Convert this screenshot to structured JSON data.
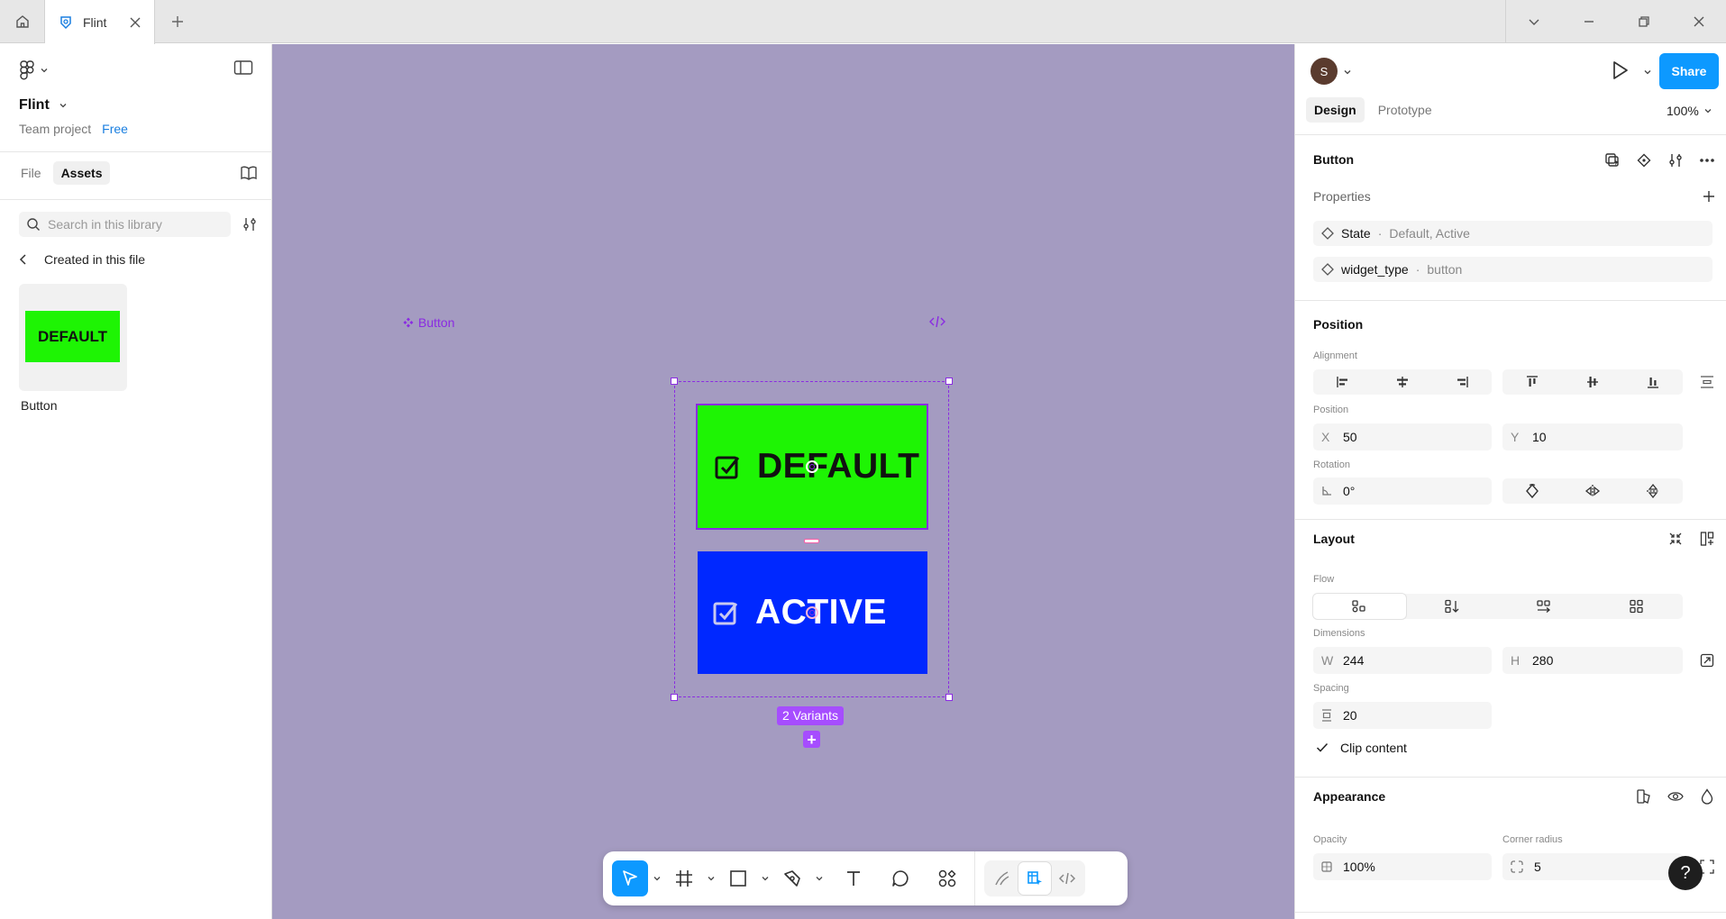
{
  "topbar": {
    "tab_title": "Flint"
  },
  "left_panel": {
    "project_name": "Flint",
    "project_type": "Team project",
    "plan_badge": "Free",
    "tabs": [
      "File",
      "Assets"
    ],
    "search_placeholder": "Search in this library",
    "back_label": "Created in this file",
    "asset": {
      "thumb_text": "DEFAULT",
      "name": "Button"
    }
  },
  "canvas": {
    "component_label": "Button",
    "variant_default_text": "DEFAULT",
    "variant_active_text": "ACTIVE",
    "variants_badge": "2 Variants",
    "background_color": "#a49bc1",
    "default_color": "#1ef404",
    "active_color": "#0028ff",
    "selection_color": "#8a2be2"
  },
  "toolbar": {
    "tools": [
      "move-tool",
      "frame-tool",
      "shape-tool",
      "pen-tool",
      "text-tool",
      "comment-tool",
      "actions-tool"
    ],
    "modes": [
      "draw-mode",
      "design-mode",
      "dev-mode"
    ]
  },
  "right_panel": {
    "avatar_initial": "S",
    "share_label": "Share",
    "tabs": [
      "Design",
      "Prototype"
    ],
    "zoom": "100%",
    "component_name": "Button",
    "properties_title": "Properties",
    "properties": [
      {
        "name": "State",
        "value": "Default, Active"
      },
      {
        "name": "widget_type",
        "value": "button"
      }
    ],
    "position": {
      "title": "Position",
      "alignment_label": "Alignment",
      "position_label": "Position",
      "x_label": "X",
      "x": "50",
      "y_label": "Y",
      "y": "10",
      "rotation_label": "Rotation",
      "rotation": "0°"
    },
    "layout": {
      "title": "Layout",
      "flow_label": "Flow",
      "dimensions_label": "Dimensions",
      "w_label": "W",
      "w": "244",
      "h_label": "H",
      "h": "280",
      "spacing_label": "Spacing",
      "spacing": "20",
      "clip_content_label": "Clip content",
      "clip_content": true
    },
    "appearance": {
      "title": "Appearance",
      "opacity_label": "Opacity",
      "opacity": "100%",
      "corner_radius_label": "Corner radius",
      "corner_radius": "5"
    },
    "help_label": "?"
  }
}
